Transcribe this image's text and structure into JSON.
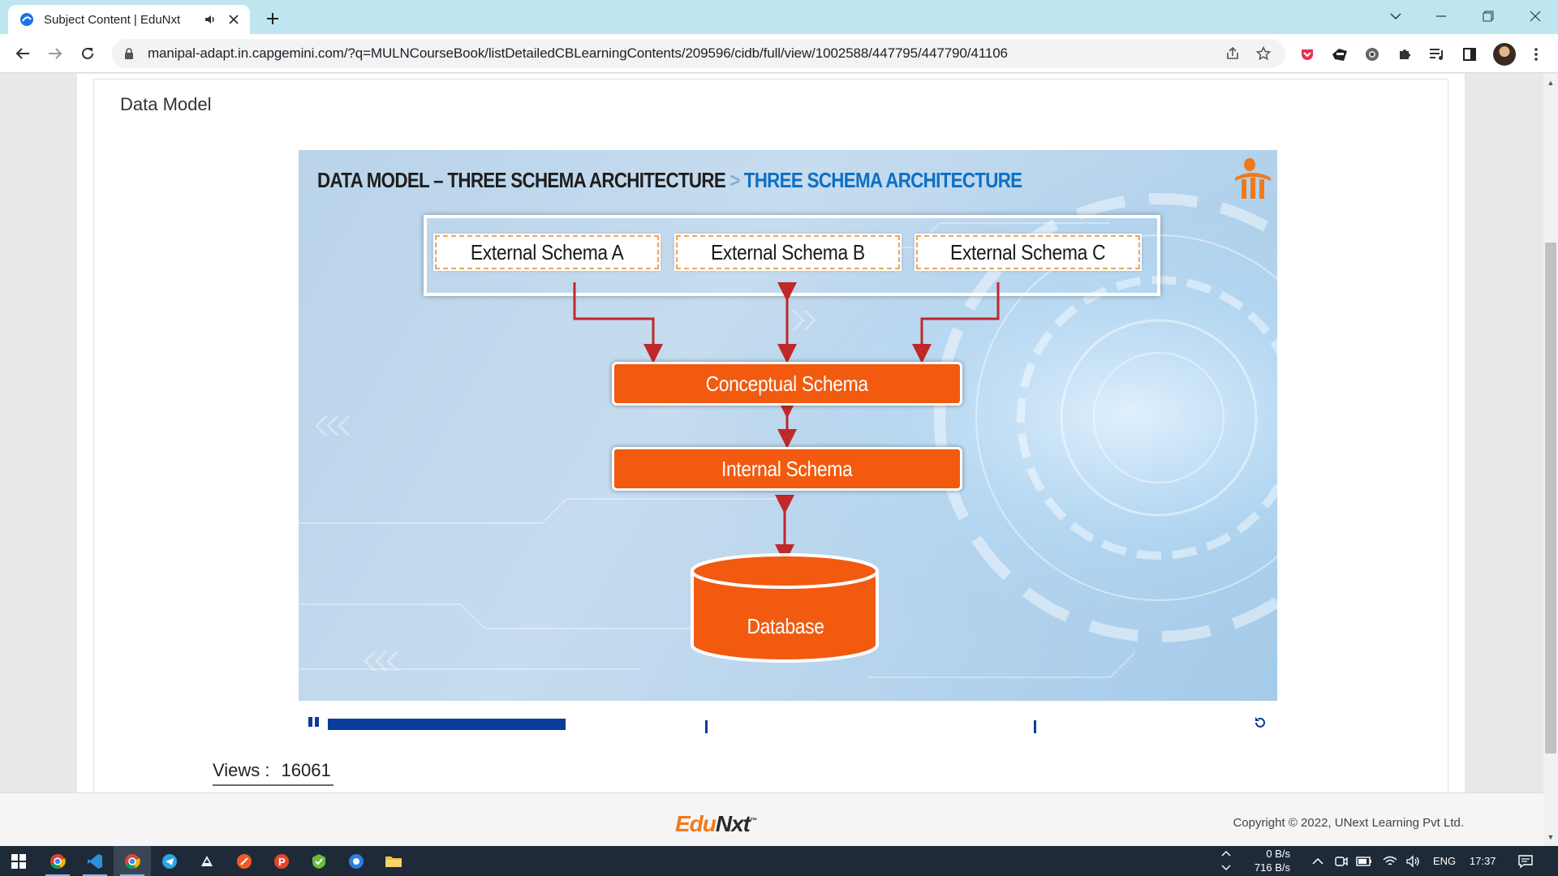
{
  "browser": {
    "tab_title": "Subject Content | EduNxt",
    "url": "manipal-adapt.in.capgemini.com/?q=MULNCourseBook/listDetailedCBLearningContents/209596/cidb/full/view/1002588/447795/447790/41106"
  },
  "page": {
    "section_title": "Data Model",
    "views_label": "Views :",
    "views_count": "16061"
  },
  "slide": {
    "title_main": "DATA MODEL – THREE SCHEMA ARCHITECTURE",
    "title_separator": ">",
    "title_sub": "THREE SCHEMA ARCHITECTURE",
    "external_schemas": [
      "External Schema A",
      "External Schema B",
      "External Schema C"
    ],
    "conceptual_schema": "Conceptual Schema",
    "internal_schema": "Internal Schema",
    "database": "Database",
    "colors": {
      "orange": "#f15a0f",
      "arrow": "#c0282a",
      "title_blue": "#0d6fc4"
    }
  },
  "player": {
    "progress": 0.262,
    "markers": [
      0.415,
      0.777
    ]
  },
  "footer": {
    "logo_edu": "Edu",
    "logo_nxt": "Nxt",
    "logo_tm": "™",
    "copyright": "Copyright © 2022, UNext Learning Pvt Ltd."
  },
  "taskbar": {
    "net_up": "0 B/s",
    "net_down": "716 B/s",
    "lang": "ENG",
    "time": "17:37"
  }
}
